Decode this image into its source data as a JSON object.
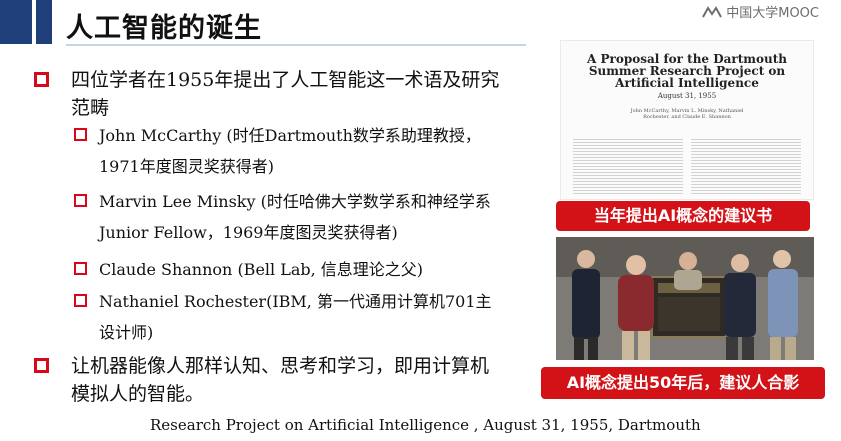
{
  "slide": {
    "title": "人工智能的诞生",
    "logo_text": "中国大学MOOC"
  },
  "bullets": [
    {
      "text": "四位学者在1955年提出了人工智能这一术语及研究范畴"
    },
    {
      "text": "让机器能像人那样认知、思考和学习，即用计算机模拟人的智能。"
    }
  ],
  "sub_bullets": [
    {
      "text": "John McCarthy (时任Dartmouth数学系助理教授，1971年度图灵奖获得者)"
    },
    {
      "text": "Marvin Lee Minsky (时任哈佛大学数学系和神经学系Junior Fellow，1969年度图灵奖获得者)"
    },
    {
      "text": "Claude Shannon (Bell Lab, 信息理论之父)"
    },
    {
      "text": "Nathaniel Rochester(IBM, 第一代通用计算机701主设计师)"
    }
  ],
  "proposal_image": {
    "title": "A Proposal for the Dartmouth Summer Research Project on Artificial Intelligence",
    "date": "August 31, 1955",
    "authors": "John McCarthy, Marvin L. Minsky, Nathaniel Rochester, and Claude E. Shannon"
  },
  "labels": {
    "proposal_label": "当年提出AI概念的建议书",
    "photo_label": "AI概念提出50年后，建议人合影"
  },
  "caption": "Research Project on Artificial Intelligence , August 31, 1955,  Dartmouth",
  "colors": {
    "accent_red": "#d31218",
    "title_bar": "#1f3f7a"
  }
}
